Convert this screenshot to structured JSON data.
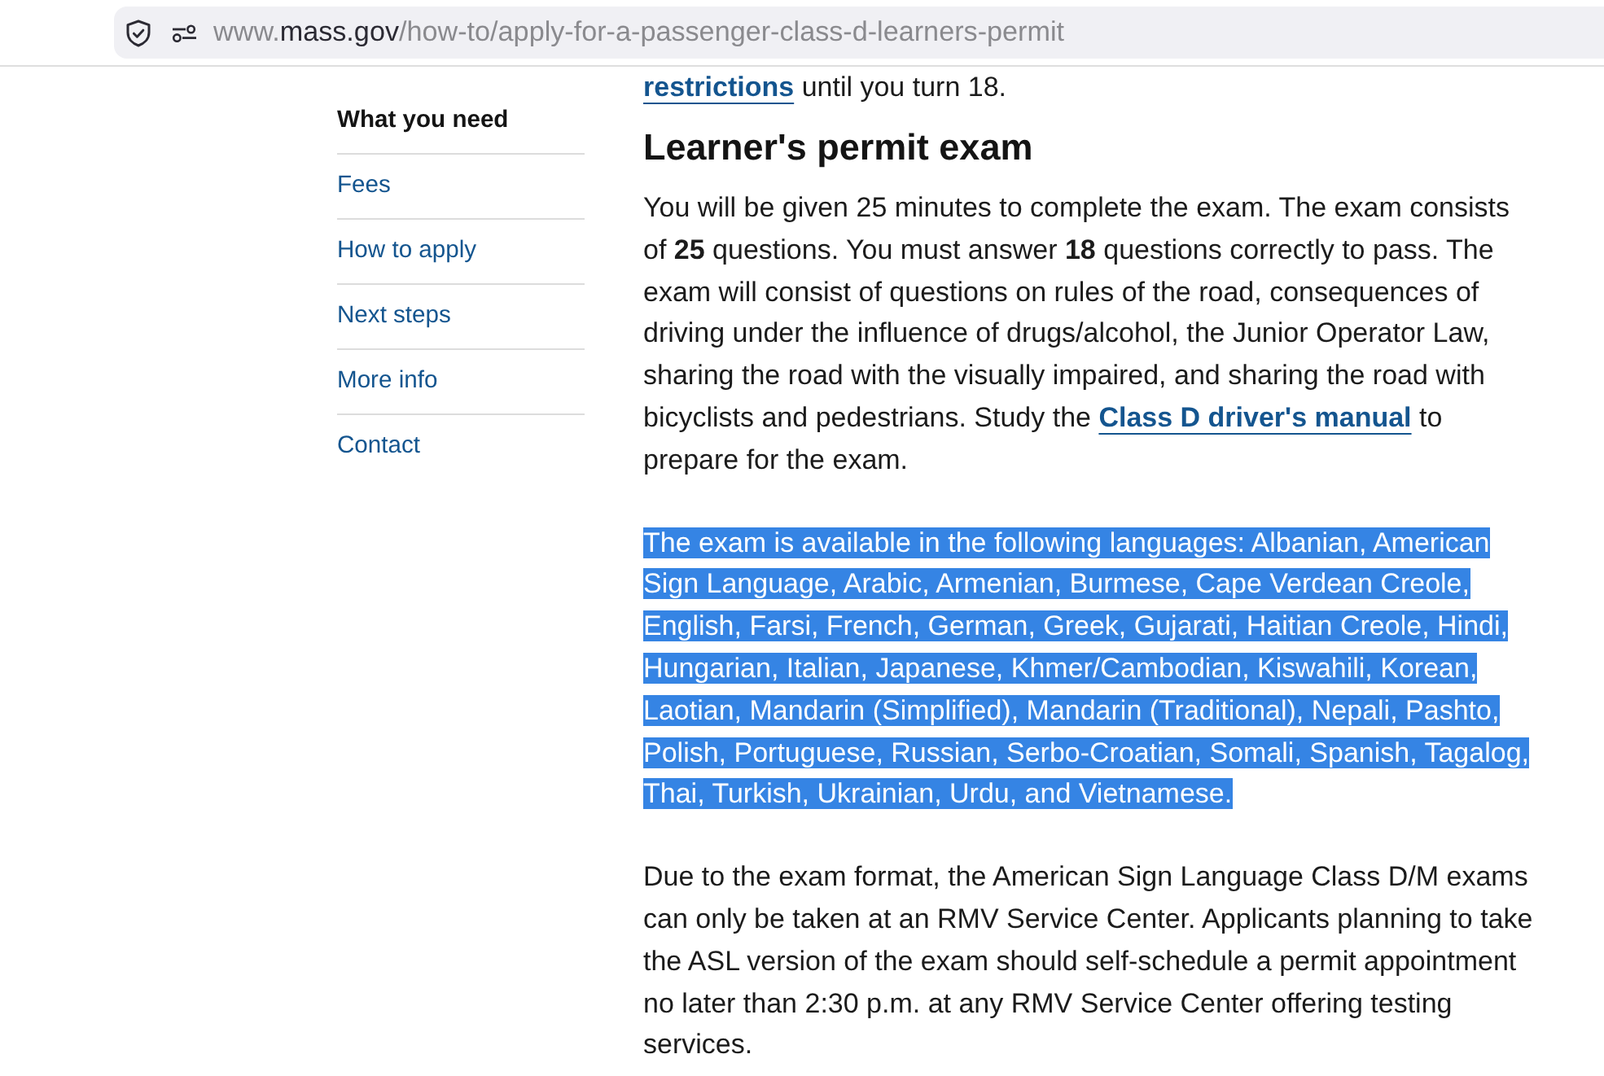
{
  "address_bar": {
    "url": [
      {
        "text": "www.",
        "kind": "muted"
      },
      {
        "text": "mass.gov",
        "kind": "host"
      },
      {
        "text": "/how-to/apply-for-a-passenger-class-d-learners-permit",
        "kind": "muted"
      }
    ]
  },
  "sidebar": {
    "items": [
      {
        "label": "What you need",
        "selected": true
      },
      {
        "label": "Fees",
        "selected": false
      },
      {
        "label": "How to apply",
        "selected": false
      },
      {
        "label": "Next steps",
        "selected": false
      },
      {
        "label": "More info",
        "selected": false
      },
      {
        "label": "Contact",
        "selected": false
      }
    ]
  },
  "content": {
    "blocks": [
      {
        "kind": "paragraph",
        "selected": false,
        "parts": [
          {
            "kind": "link",
            "text": "restrictions"
          },
          {
            "kind": "text",
            "text": " until you turn 18."
          }
        ]
      },
      {
        "kind": "heading",
        "text": "Learner's permit exam"
      },
      {
        "kind": "paragraph",
        "selected": false,
        "parts": [
          {
            "kind": "text",
            "text": "You will be given 25 minutes to complete the exam. The exam consists of "
          },
          {
            "kind": "bold",
            "text": "25"
          },
          {
            "kind": "text",
            "text": " questions. You must answer "
          },
          {
            "kind": "bold",
            "text": "18"
          },
          {
            "kind": "text",
            "text": " questions correctly to pass. The exam will consist of questions on rules of the road, consequences of driving under the influence of drugs/alcohol, the Junior Operator Law, sharing the road with the visually impaired, and sharing the road with bicyclists and pedestrians. Study the "
          },
          {
            "kind": "link",
            "text": "Class D driver's manual"
          },
          {
            "kind": "text",
            "text": " to prepare for the exam."
          }
        ]
      },
      {
        "kind": "paragraph",
        "selected": true,
        "parts": [
          {
            "kind": "text",
            "text": "The exam is available in the following languages: Albanian, American Sign Language, Arabic, Armenian, Burmese, Cape Verdean Creole, English, Farsi, French, German, Greek, Gujarati, Haitian Creole, Hindi, Hungarian, Italian, Japanese, Khmer/Cambodian, Kiswahili, Korean, Laotian, Mandarin (Simplified), Mandarin (Traditional), Nepali, Pashto, Polish, Portuguese, Russian, Serbo-Croatian, Somali, Spanish, Tagalog, Thai, Turkish, Ukrainian, Urdu, and Vietnamese."
          }
        ]
      },
      {
        "kind": "paragraph",
        "selected": false,
        "parts": [
          {
            "kind": "text",
            "text": "Due to the exam format, the American Sign Language Class D/M exams can only be taken at an RMV Service Center. Applicants planning to take the ASL version of the exam should self-schedule a permit appointment no later than 2:30 p.m. at any RMV Service Center offering testing services."
          }
        ]
      }
    ]
  }
}
